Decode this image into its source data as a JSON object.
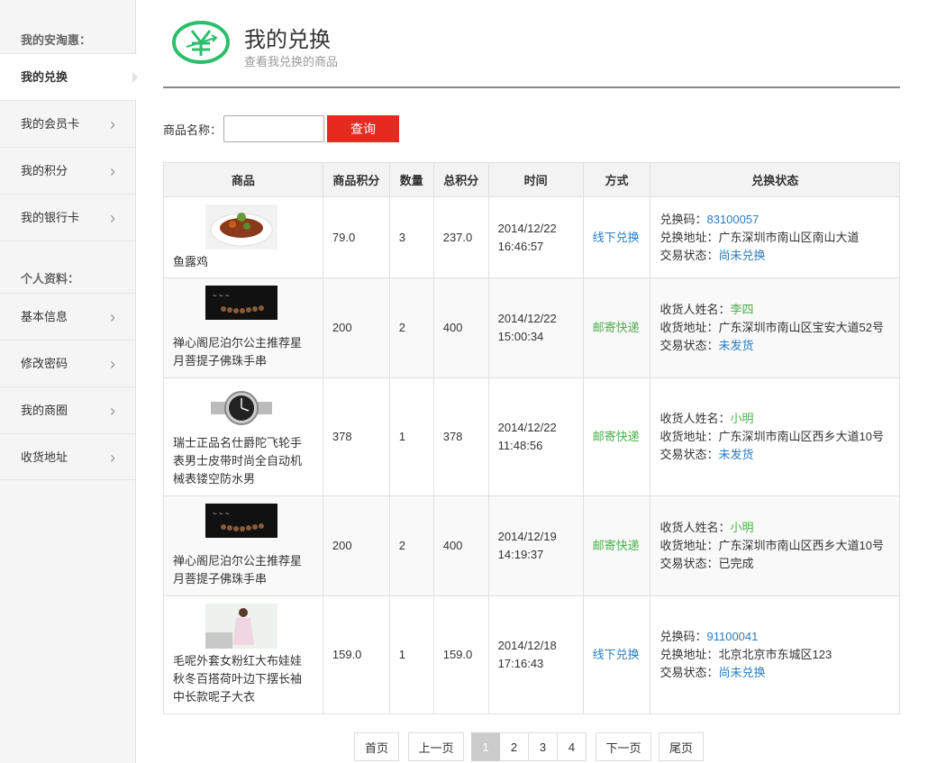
{
  "sidebar": {
    "section1": "我的安淘惠：",
    "items1": [
      {
        "label": "我的兑换",
        "active": true
      },
      {
        "label": "我的会员卡"
      },
      {
        "label": "我的积分"
      },
      {
        "label": "我的银行卡"
      }
    ],
    "section2": "个人资料：",
    "items2": [
      {
        "label": "基本信息"
      },
      {
        "label": "修改密码"
      },
      {
        "label": "我的商圈"
      },
      {
        "label": "收货地址"
      }
    ],
    "chevron": "›"
  },
  "header": {
    "title": "我的兑换",
    "subtitle": "查看我兑换的商品",
    "logo_icon": "yen-exchange-icon",
    "accent": "#2dbe6c"
  },
  "search": {
    "label": "商品名称：",
    "placeholder": "",
    "value": "",
    "button": "查询",
    "button_color": "#e52a20"
  },
  "table": {
    "headers": [
      "商品",
      "商品积分",
      "数量",
      "总积分",
      "时间",
      "方式",
      "兑换状态"
    ],
    "rows": [
      {
        "image": "food-thumbnail",
        "name": "鱼露鸡",
        "points": "79.0",
        "qty": "3",
        "total": "237.0",
        "date": "2014/12/22",
        "time": "16:46:57",
        "method": "线下兑换",
        "s1_label": "兑换码：",
        "s1_value": "83100057",
        "s2_label": "兑换地址：",
        "s2_value": "广东深圳市南山区南山大道",
        "s3_label": "交易状态：",
        "s3_value": "尚未兑换"
      },
      {
        "image": "bracelet-thumbnail",
        "name": "禅心阁尼泊尔公主推荐星月菩提子佛珠手串",
        "points": "200",
        "qty": "2",
        "total": "400",
        "date": "2014/12/22",
        "time": "15:00:34",
        "method": "邮寄快递",
        "s1_label": "收货人姓名：",
        "s1_value": "李四",
        "s2_label": "收货地址：",
        "s2_value": "广东深圳市南山区宝安大道52号",
        "s3_label": "交易状态：",
        "s3_value": "未发货"
      },
      {
        "image": "watch-thumbnail",
        "name": "瑞士正品名仕爵陀飞轮手表男士皮带时尚全自动机械表镂空防水男",
        "points": "378",
        "qty": "1",
        "total": "378",
        "date": "2014/12/22",
        "time": "11:48:56",
        "method": "邮寄快递",
        "s1_label": "收货人姓名：",
        "s1_value": "小明",
        "s2_label": "收货地址：",
        "s2_value": "广东深圳市南山区西乡大道10号",
        "s3_label": "交易状态：",
        "s3_value": "未发货"
      },
      {
        "image": "bracelet-thumbnail",
        "name": "禅心阁尼泊尔公主推荐星月菩提子佛珠手串",
        "points": "200",
        "qty": "2",
        "total": "400",
        "date": "2014/12/19",
        "time": "14:19:37",
        "method": "邮寄快递",
        "s1_label": "收货人姓名：",
        "s1_value": "小明",
        "s2_label": "收货地址：",
        "s2_value": "广东深圳市南山区西乡大道10号",
        "s3_label": "交易状态：",
        "s3_value": "已完成"
      },
      {
        "image": "coat-thumbnail",
        "name": "毛呢外套女粉红大布娃娃秋冬百搭荷叶边下摆长袖中长款呢子大衣",
        "points": "159.0",
        "qty": "1",
        "total": "159.0",
        "date": "2014/12/18",
        "time": "17:16:43",
        "method": "线下兑换",
        "s1_label": "兑换码：",
        "s1_value": "91100041",
        "s2_label": "兑换地址：",
        "s2_value": "北京北京市东城区123",
        "s3_label": "交易状态：",
        "s3_value": "尚未兑换"
      }
    ]
  },
  "pager": {
    "first": "首页",
    "prev": "上一页",
    "pages": [
      "1",
      "2",
      "3",
      "4"
    ],
    "current": "1",
    "next": "下一页",
    "last": "尾页"
  }
}
